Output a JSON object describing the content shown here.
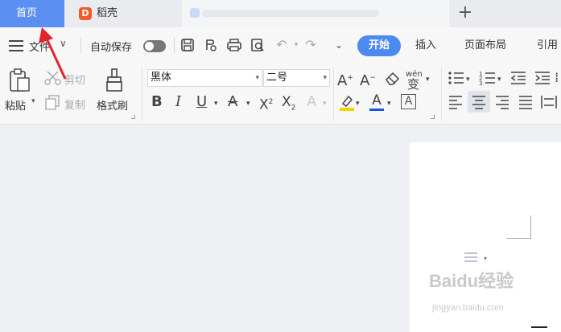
{
  "tabs": {
    "home_label": "首页",
    "doc_label": "稻壳",
    "doc_icon_letter": "D",
    "add_label": "+"
  },
  "menu": {
    "file_label": "文件",
    "autosave_label": "自动保存",
    "ribbon_tabs": [
      "开始",
      "插入",
      "页面布局",
      "引用"
    ]
  },
  "clipboard": {
    "paste_label": "粘贴",
    "cut_label": "剪切",
    "copy_label": "复制",
    "format_painter_label": "格式刷"
  },
  "font": {
    "family_value": "黑体",
    "size_value": "二号",
    "phonetic_label": "wén"
  },
  "colors": {
    "home_tab": "#5b8ff1",
    "start_tab": "#4c89f0",
    "highlight": "#f4d400",
    "font_color": "#1a55d6",
    "annotation_arrow": "#e0242a"
  },
  "watermark": {
    "brand": "Baidu经验",
    "url": "jingyan.baidu.com"
  }
}
